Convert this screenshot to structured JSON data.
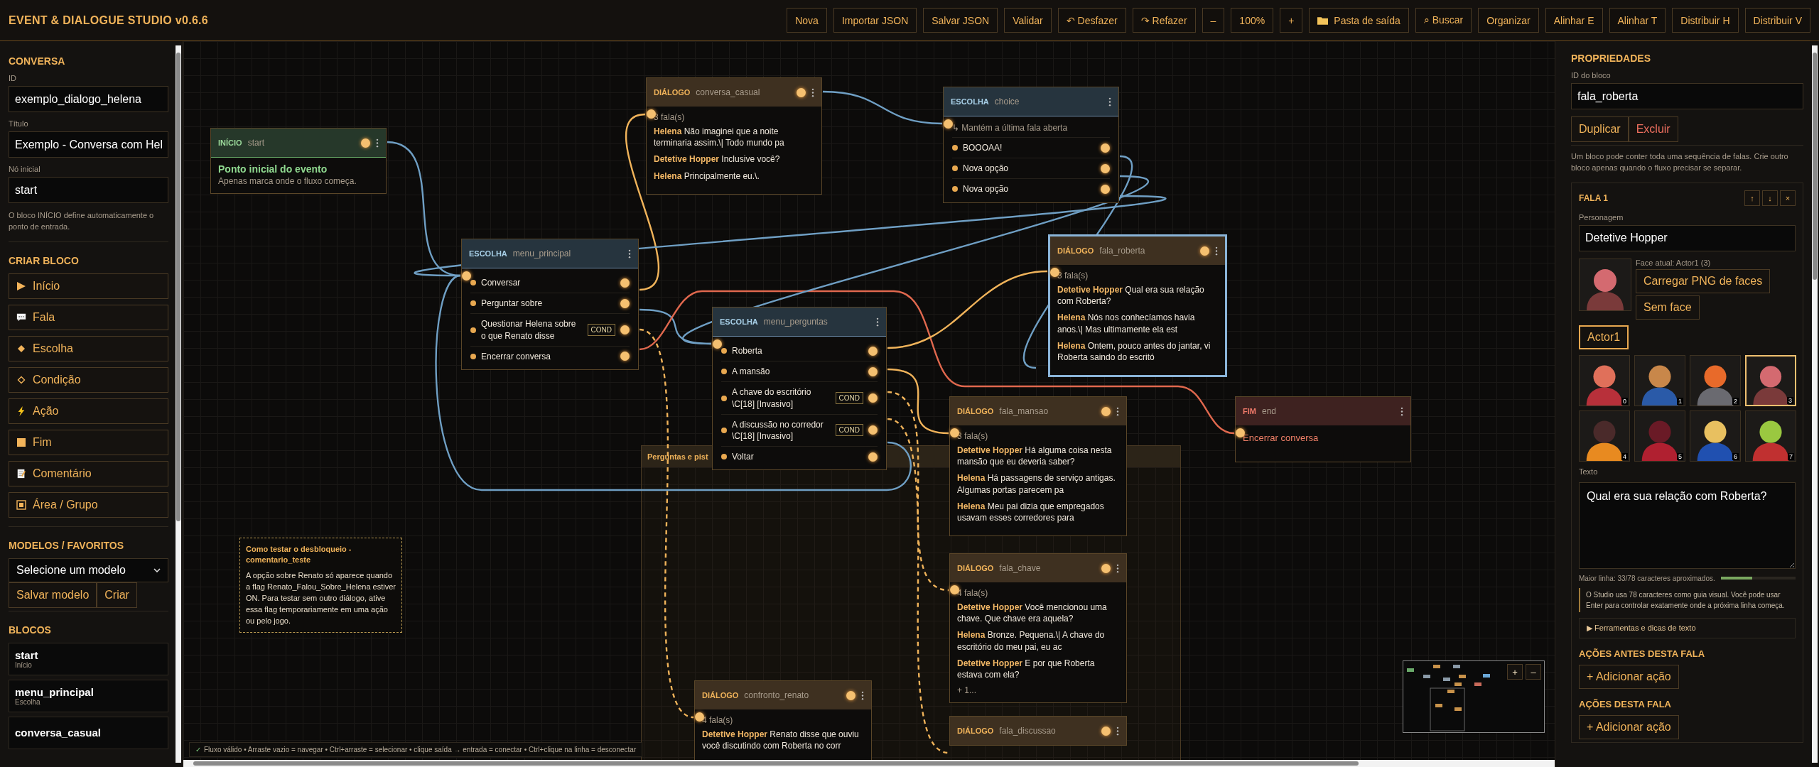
{
  "app": {
    "title": "EVENT & DIALOGUE STUDIO v0.6.6"
  },
  "toolbar": [
    {
      "label": "Nova"
    },
    {
      "label": "Importar JSON"
    },
    {
      "label": "Salvar JSON"
    },
    {
      "label": "Validar"
    },
    {
      "label": "↶ Desfazer"
    },
    {
      "label": "↷ Refazer"
    },
    {
      "label": "–"
    },
    {
      "label": "100%"
    },
    {
      "label": "+"
    },
    {
      "label": "Pasta de saída"
    },
    {
      "label": "⌕ Buscar"
    },
    {
      "label": "Organizar"
    },
    {
      "label": "Alinhar E"
    },
    {
      "label": "Alinhar T"
    },
    {
      "label": "Distribuir H"
    },
    {
      "label": "Distribuir V"
    }
  ],
  "sidebar": {
    "conversa": {
      "heading": "CONVERSA",
      "fields": [
        {
          "label": "ID",
          "value": "exemplo_dialogo_helena"
        },
        {
          "label": "Título",
          "value": "Exemplo - Conversa com Hel"
        },
        {
          "label": "Nó inicial",
          "value": "start"
        }
      ],
      "note": "O bloco INÍCIO define automaticamente o ponto de entrada."
    },
    "criar_bloco": {
      "heading": "CRIAR BLOCO",
      "items": [
        {
          "label": "Início"
        },
        {
          "label": "Fala"
        },
        {
          "label": "Escolha"
        },
        {
          "label": "Condição"
        },
        {
          "label": "Ação"
        },
        {
          "label": "Fim"
        },
        {
          "label": "Comentário"
        },
        {
          "label": "Área / Grupo"
        }
      ]
    },
    "modelos": {
      "heading": "MODELOS / FAVORITOS",
      "select": "Selecione um modelo",
      "buttons": [
        "Salvar modelo",
        "Criar"
      ]
    },
    "blocos": {
      "heading": "BLOCOS",
      "items": [
        {
          "name": "start",
          "type": "Início"
        },
        {
          "name": "menu_principal",
          "type": "Escolha"
        },
        {
          "name": "conversa_casual"
        }
      ]
    }
  },
  "canvas": {
    "nodes": [
      {
        "kind": "inicio",
        "type": "INÍCIO",
        "id": "start",
        "title": "Ponto inicial do evento",
        "subtitle": "Apenas marca onde o fluxo começa.",
        "selected": false
      },
      {
        "kind": "dialogo",
        "type": "DIÁLOGO",
        "id": "conversa_casual",
        "count": "3 fala(s)",
        "selected": false,
        "lines": [
          {
            "speaker": "Helena",
            "text": "Não imaginei que a noite terminaria assim.\\| Todo mundo pa"
          },
          {
            "speaker": "Detetive Hopper",
            "text": "Inclusive você?"
          },
          {
            "speaker": "Helena",
            "text": "Principalmente eu.\\."
          }
        ]
      },
      {
        "kind": "escolha",
        "type": "ESCOLHA",
        "id": "choice",
        "note": "↳ Mantém a última fala aberta",
        "selected": false,
        "options": [
          {
            "label": "BOOOAA!"
          },
          {
            "label": "Nova opção"
          },
          {
            "label": "Nova opção"
          }
        ]
      },
      {
        "kind": "escolha",
        "type": "ESCOLHA",
        "id": "menu_principal",
        "selected": false,
        "options": [
          {
            "label": "Conversar"
          },
          {
            "label": "Perguntar sobre"
          },
          {
            "label": "Questionar Helena sobre o que Renato disse",
            "badge": "COND"
          },
          {
            "label": "Encerrar conversa"
          }
        ]
      },
      {
        "kind": "dialogo",
        "type": "DIÁLOGO",
        "id": "fala_roberta",
        "count": "3 fala(s)",
        "selected": true,
        "lines": [
          {
            "speaker": "Detetive Hopper",
            "text": "Qual era sua relação com Roberta?"
          },
          {
            "speaker": "Helena",
            "text": "Nós nos conhecíamos havia anos.\\| Mas ultimamente ela est"
          },
          {
            "speaker": "Helena",
            "text": "Ontem, pouco antes do jantar, vi Roberta saindo do escritó"
          }
        ]
      },
      {
        "kind": "grupo",
        "title": "Perguntas e pist"
      },
      {
        "kind": "escolha",
        "type": "ESCOLHA",
        "id": "menu_perguntas",
        "selected": false,
        "options": [
          {
            "label": "Roberta"
          },
          {
            "label": "A mansão"
          },
          {
            "label": "A chave do escritório \\C[18] [Invasivo]",
            "badge": "COND"
          },
          {
            "label": "A discussão no corredor \\C[18] [Invasivo]",
            "badge": "COND"
          },
          {
            "label": "Voltar"
          }
        ]
      },
      {
        "kind": "dialogo",
        "type": "DIÁLOGO",
        "id": "fala_mansao",
        "count": "3 fala(s)",
        "selected": false,
        "lines": [
          {
            "speaker": "Detetive Hopper",
            "text": "Há alguma coisa nesta mansão que eu deveria saber?"
          },
          {
            "speaker": "Helena",
            "text": "Há passagens de serviço antigas. Algumas portas parecem pa"
          },
          {
            "speaker": "Helena",
            "text": "Meu pai dizia que empregados usavam esses corredores para"
          }
        ]
      },
      {
        "kind": "fim",
        "type": "FIM",
        "id": "end",
        "text": "Encerrar conversa",
        "selected": false
      },
      {
        "kind": "comentario",
        "title": "Como testar o desbloqueio - comentario_teste",
        "text": "A opção sobre Renato só aparece quando a flag Renato_Falou_Sobre_Helena estiver ON. Para testar sem outro diálogo, ative essa flag temporariamente em uma ação ou pelo jogo."
      },
      {
        "kind": "dialogo",
        "type": "DIÁLOGO",
        "id": "fala_chave",
        "count": "4 fala(s)",
        "selected": false,
        "more": "+ 1...",
        "lines": [
          {
            "speaker": "Detetive Hopper",
            "text": "Você mencionou uma chave. Que chave era aquela?"
          },
          {
            "speaker": "Helena",
            "text": "Bronze. Pequena.\\| A chave do escritório do meu pai, eu ac"
          },
          {
            "speaker": "Detetive Hopper",
            "text": "E por que Roberta estava com ela?"
          }
        ]
      },
      {
        "kind": "dialogo",
        "type": "DIÁLOGO",
        "id": "confronto_renato",
        "count": "4 fala(s)",
        "selected": false,
        "lines": [
          {
            "speaker": "Detetive Hopper",
            "text": "Renato disse que ouviu você discutindo com Roberta no corr"
          }
        ]
      },
      {
        "kind": "dialogo",
        "type": "DIÁLOGO",
        "id": "fala_discussao",
        "selected": false
      }
    ],
    "status": {
      "check": "✓",
      "text": "Fluxo válido • Arraste vazio = navegar • Ctrl+arraste = selecionar • clique saída → entrada = conectar • Ctrl+clique na linha = desconectar"
    },
    "zoom_buttons": [
      "+",
      "–"
    ]
  },
  "properties": {
    "heading": "PROPRIEDADES",
    "id_label": "ID do bloco",
    "id_value": "fala_roberta",
    "buttons": [
      {
        "label": "Duplicar",
        "kind": "normal"
      },
      {
        "label": "Excluir",
        "kind": "danger"
      }
    ],
    "note": "Um bloco pode conter toda uma sequência de falas. Crie outro bloco apenas quando o fluxo precisar se separar.",
    "fala": {
      "title": "FALA 1",
      "controls": [
        "↑",
        "↓",
        "×"
      ],
      "character_label": "Personagem",
      "character": "Detetive Hopper",
      "face_current": "Face atual: Actor1 (3)",
      "face_buttons": [
        "Carregar PNG de faces",
        "Sem face"
      ],
      "sheets": [
        {
          "label": "Actor1",
          "selected": true
        }
      ],
      "faces": [
        {
          "label": "0",
          "selected": false
        },
        {
          "label": "1",
          "selected": false
        },
        {
          "label": "2",
          "selected": false
        },
        {
          "label": "3",
          "selected": true
        },
        {
          "label": "4",
          "selected": false
        },
        {
          "label": "5",
          "selected": false
        },
        {
          "label": "6",
          "selected": false
        },
        {
          "label": "7",
          "selected": false
        }
      ],
      "text_label": "Texto",
      "text": "Qual era sua relação com Roberta?",
      "length_text": "Maior linha: 33/78 caracteres aproximados.",
      "level": 0.42,
      "hint": "O Studio usa 78 caracteres como guia visual. Você pode usar Enter para controlar exatamente onde a próxima linha começa.",
      "tools": "▶ Ferramentas e dicas de texto",
      "sections": [
        {
          "heading": "AÇÕES ANTES DESTA FALA",
          "button": "+ Adicionar ação"
        },
        {
          "heading": "AÇÕES DESTA FALA",
          "button": "+ Adicionar ação"
        }
      ]
    }
  }
}
